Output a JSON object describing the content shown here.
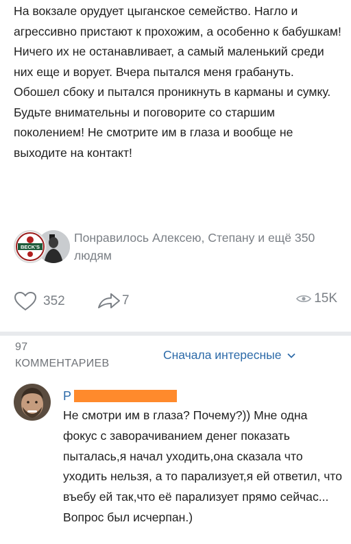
{
  "post": {
    "text": "На вокзале орудует цыганское семейство. Нагло и агрессивно пристают к прохожим, а особенно к бабушкам! Ничего их не останавливает, а самый маленький среди них еще и ворует. Вчера пытался меня грабануть. Обошел сбоку и пытался проникнуть в карманы и сумку. Будьте внимательны и поговорите со старшим поколением! Не смотрите им в глаза и вообще не выходите на контакт!",
    "liked_by": "Понравилось Алексею, Степану и ещё 350 людям",
    "liker_avatar_logo": "BECK'S",
    "likes": "352",
    "shares": "7",
    "views": "15K"
  },
  "comments_section": {
    "count": "97",
    "label": "КОММЕНТАРИЕВ",
    "sort": "Сначала интересные"
  },
  "comment": {
    "author_initial": "Р",
    "text": "Не смотри им в глаза? Почему?)) Мне одна фокус с заворачиванием денег показать пыталась,я начал уходить,она сказала что уходить нельзя, а то парализует,я ей ответил, что въебу ей так,что её парализует прямо сейчас... Вопрос был исчерпан.)"
  },
  "colors": {
    "link": "#2c6aa8",
    "muted": "#7a7f85",
    "redaction": "#ff8a2c",
    "divider": "#e8eaed"
  },
  "icons": [
    "heart-icon",
    "share-icon",
    "eye-icon",
    "chevron-down-icon"
  ]
}
